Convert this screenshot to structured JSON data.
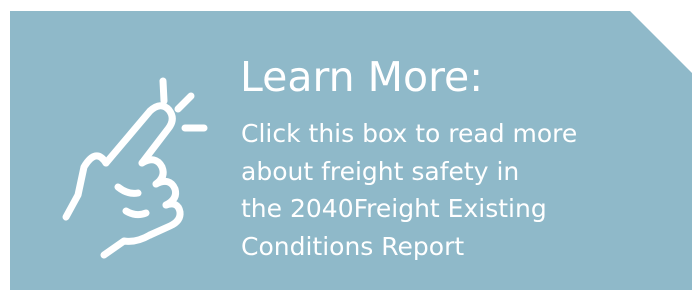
{
  "card": {
    "background_color": "#8fb9c9",
    "icon": "pointing-finger-click-icon",
    "heading": "Learn More:",
    "body_lines": [
      "Click this box to read more",
      "about freight safety in",
      "the 2040Freight Existing",
      "Conditions Report"
    ]
  }
}
